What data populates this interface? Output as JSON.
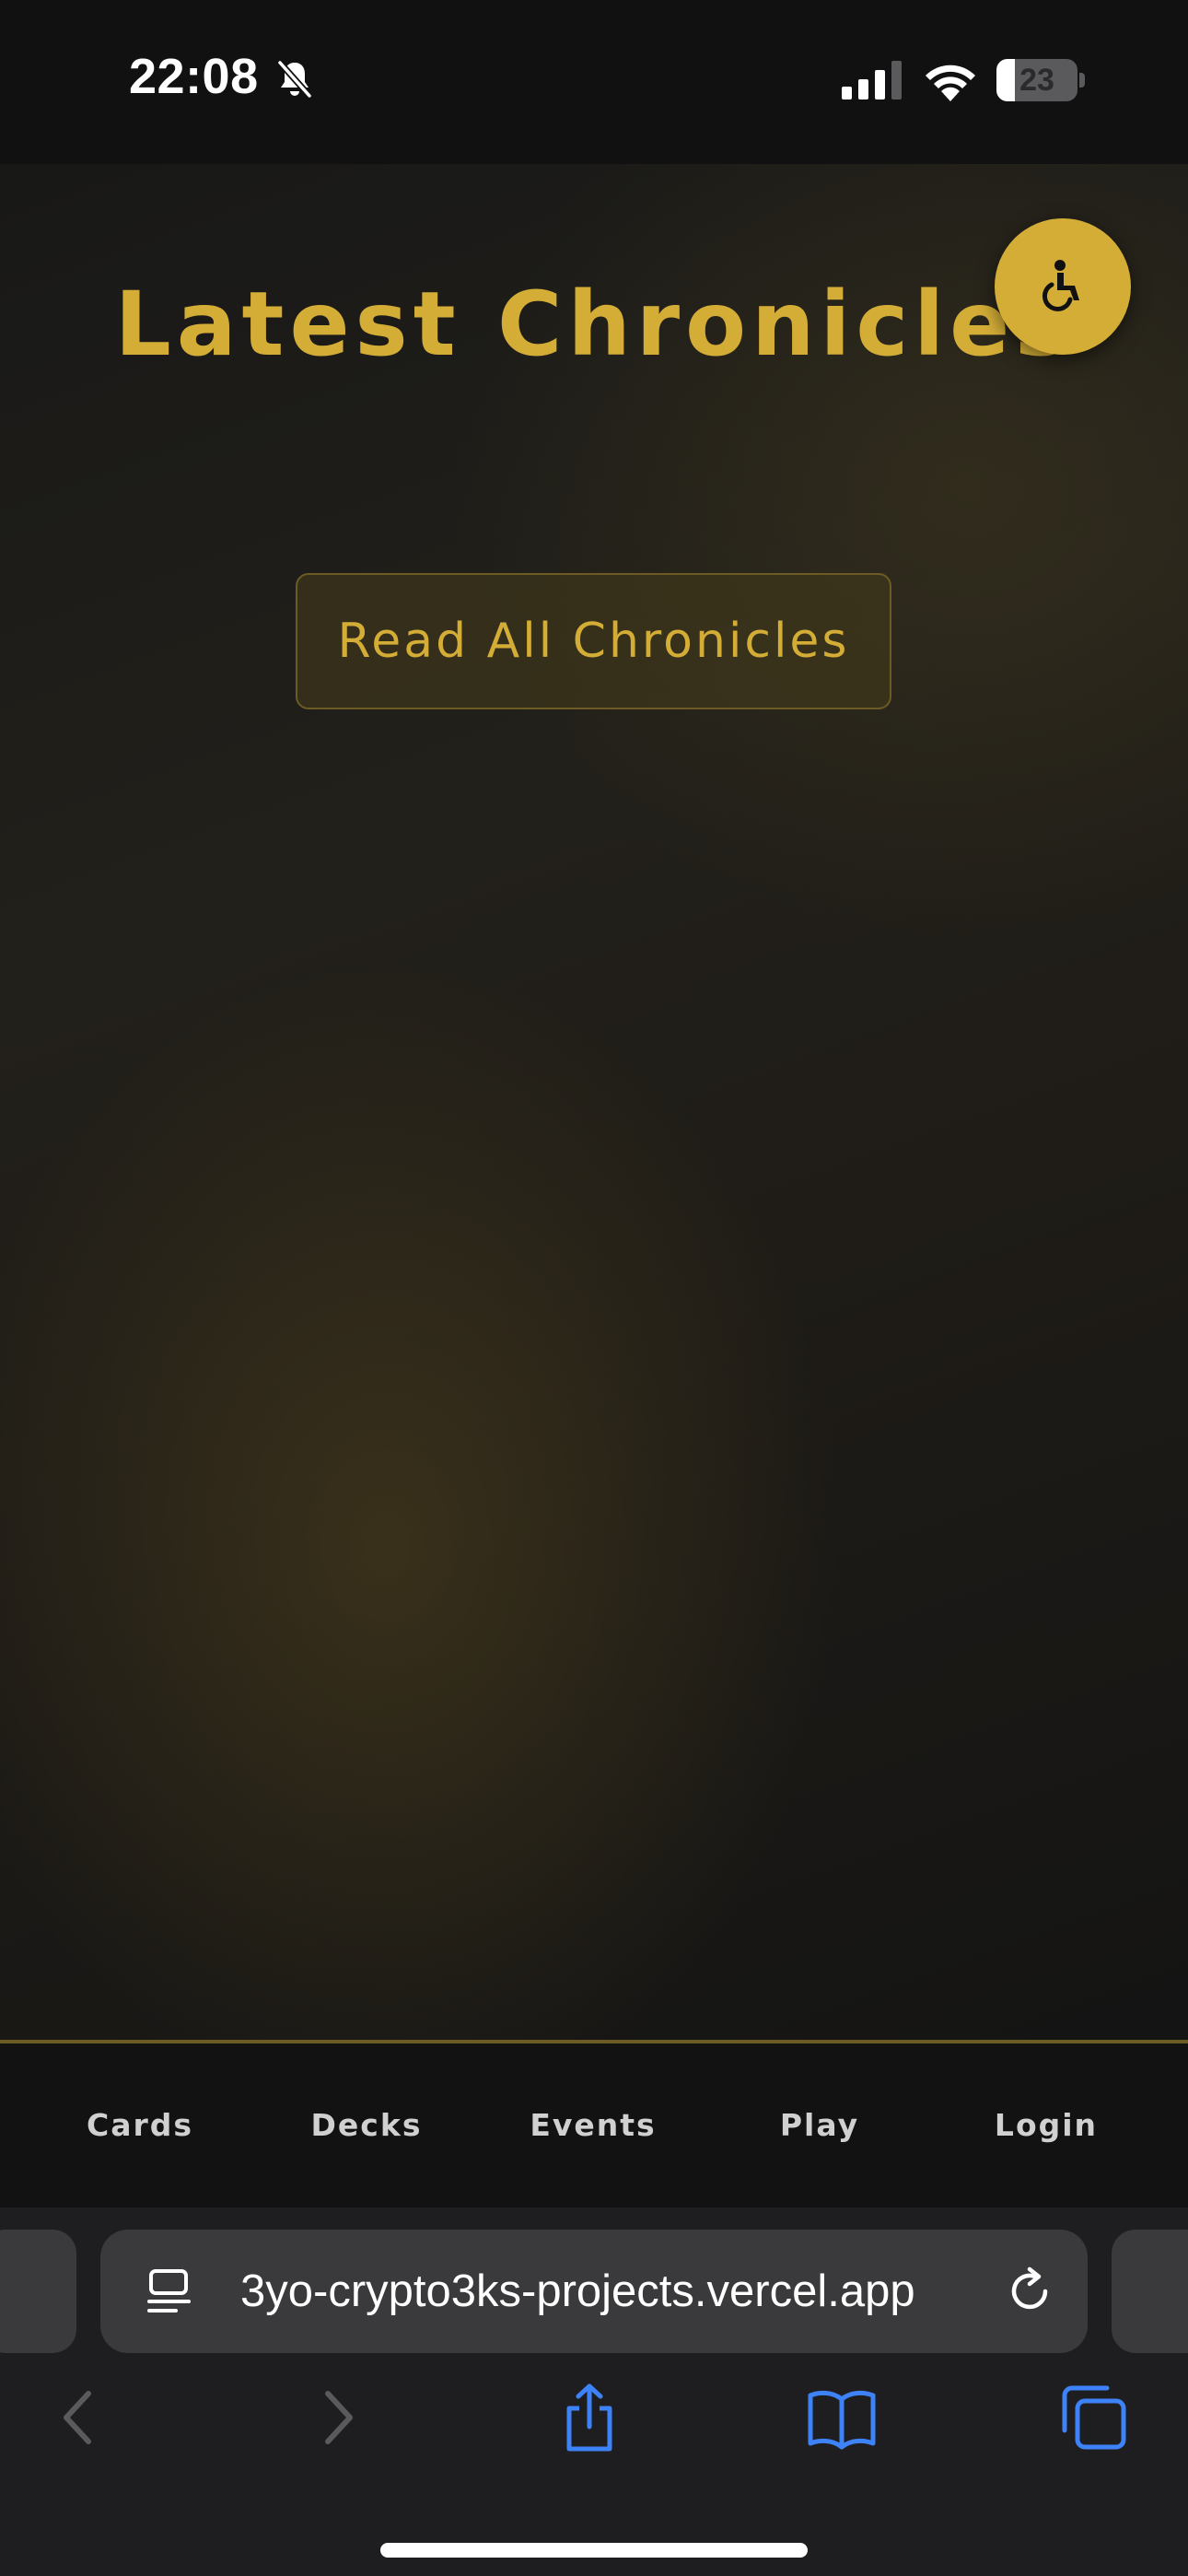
{
  "status_bar": {
    "time": "22:08",
    "battery_level": "23",
    "battery_fraction": 0.23,
    "icons": [
      "bell-slash-icon",
      "signal-icon",
      "wifi-icon",
      "battery-icon"
    ]
  },
  "page": {
    "title": "Latest Chronicles",
    "read_all_button": "Read All Chronicles",
    "accessibility_icon": "wheelchair-icon",
    "accent_color": "#d4ad37"
  },
  "nav": {
    "items": [
      {
        "label": "Cards"
      },
      {
        "label": "Decks"
      },
      {
        "label": "Events"
      },
      {
        "label": "Play"
      },
      {
        "label": "Login"
      }
    ]
  },
  "browser": {
    "url": "3yo-crypto3ks-projects.vercel.app",
    "toolbar_icons": [
      "back-icon",
      "forward-icon",
      "share-icon",
      "bookmarks-icon",
      "tabs-icon"
    ],
    "accent_color": "#3e82f7"
  }
}
